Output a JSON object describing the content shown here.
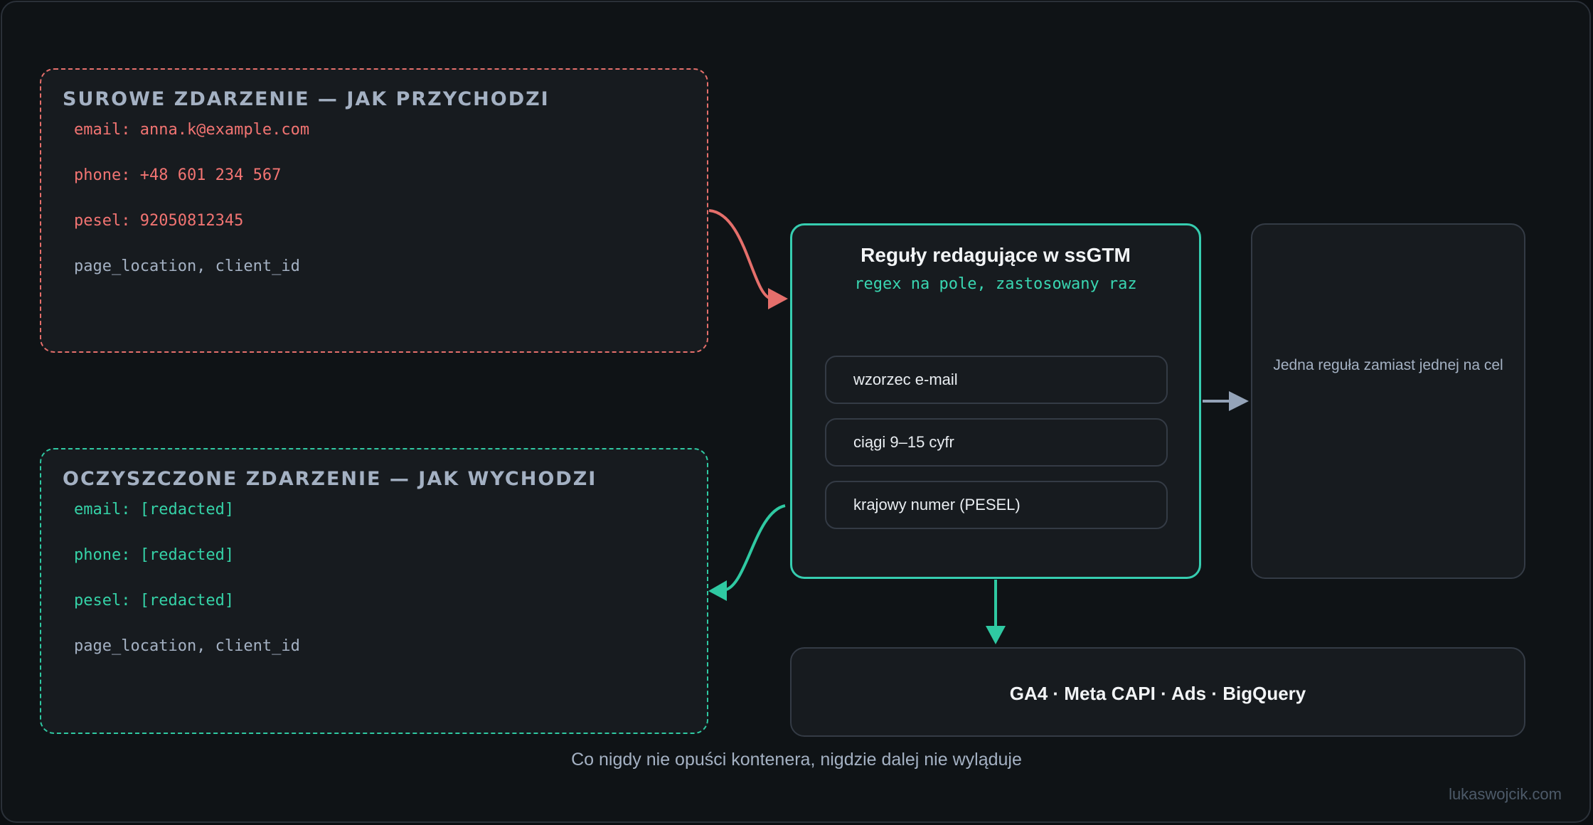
{
  "raw_event": {
    "title": "SUROWE ZDARZENIE — JAK PRZYCHODZI",
    "fields": [
      "email: anna.k@example.com",
      "phone: +48 601 234 567",
      "pesel: 92050812345",
      "page_location, client_id"
    ]
  },
  "clean_event": {
    "title": "OCZYSZCZONE ZDARZENIE — JAK WYCHODZI",
    "fields": [
      "email: [redacted]",
      "phone: [redacted]",
      "pesel: [redacted]",
      "page_location, client_id"
    ]
  },
  "rules": {
    "title": "Reguły redagujące w ssGTM",
    "subtitle": "regex na pole, zastosowany raz",
    "patterns": [
      "wzorzec e-mail",
      "ciągi 9–15 cyfr",
      "krajowy numer (PESEL)"
    ]
  },
  "note": {
    "text": "Jedna reguła zamiast jednej na cel"
  },
  "destinations": {
    "text": "GA4 · Meta CAPI · Ads · BigQuery"
  },
  "caption": "Co nigdy nie opuści kontenera, nigdzie dalej nie wyląduje",
  "credit": "lukaswojcik.com",
  "colors": {
    "raw_accent": "#e56f6b",
    "clean_accent": "#2fc9a2",
    "neutral_arrow": "#94a3b8",
    "background": "#0f1316",
    "panel": "#171b1f"
  }
}
